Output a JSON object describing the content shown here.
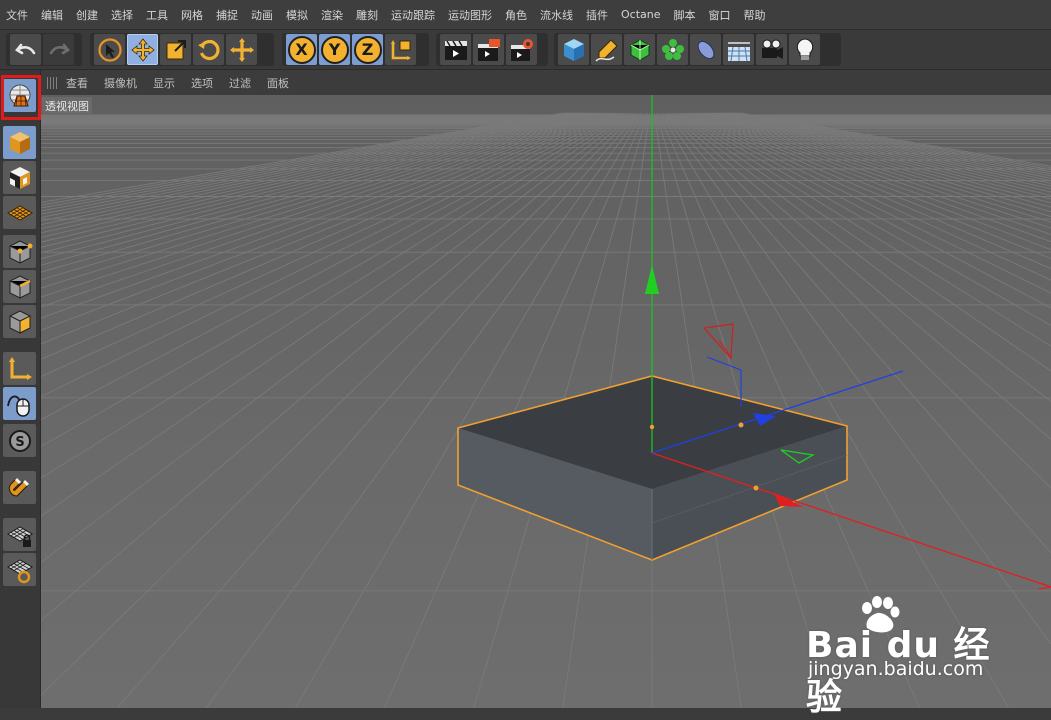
{
  "menubar": {
    "items": [
      "文件",
      "编辑",
      "创建",
      "选择",
      "工具",
      "网格",
      "捕捉",
      "动画",
      "模拟",
      "渲染",
      "雕刻",
      "运动跟踪",
      "运动图形",
      "角色",
      "流水线",
      "插件",
      "Octane",
      "脚本",
      "窗口",
      "帮助"
    ]
  },
  "toolbar": {
    "groups": [
      {
        "name": "history",
        "buttons": [
          "undo-icon",
          "redo-icon"
        ]
      },
      {
        "name": "transform",
        "buttons": [
          "live-select-icon",
          "move-icon",
          "scale-icon",
          "rotate-icon",
          "last-tool-icon"
        ]
      },
      {
        "name": "axis-lock",
        "buttons": [
          "x-axis-icon",
          "y-axis-icon",
          "z-axis-icon",
          "coordinate-system-icon"
        ]
      },
      {
        "name": "render",
        "buttons": [
          "render-view-icon",
          "render-picture-viewer-icon",
          "render-settings-icon"
        ]
      },
      {
        "name": "create",
        "buttons": [
          "cube-object-icon",
          "pen-spline-icon",
          "subdivision-surface-icon",
          "cloner-icon",
          "deformer-icon",
          "floor-environment-icon",
          "camera-icon",
          "light-icon"
        ]
      }
    ],
    "axis_labels": {
      "x": "X",
      "y": "Y",
      "z": "Z"
    }
  },
  "viewport_menu": {
    "items": [
      "查看",
      "摄像机",
      "显示",
      "选项",
      "过滤",
      "面板"
    ]
  },
  "viewport": {
    "label": "透视视图"
  },
  "left_toolbar": {
    "buttons": [
      "make-editable-icon",
      "model-mode-icon",
      "texture-mode-icon",
      "workplane-mode-icon",
      "points-mode-icon",
      "edges-mode-icon",
      "polygons-mode-icon",
      "axis-mode-icon",
      "tweak-mode-icon",
      "solo-icon",
      "snap-magnet-icon",
      "workplane-lock-icon",
      "workplane-align-icon"
    ],
    "highlighted": "make-editable-icon"
  },
  "colors": {
    "grid_line": "#7a7a7a",
    "object_outline": "#f0a030",
    "axis_x": "#e02020",
    "axis_y": "#20c020",
    "axis_z": "#2040e0",
    "highlight": "#e21a1a"
  },
  "watermark": {
    "logo": "Bai du 经验",
    "url": "jingyan.baidu.com"
  }
}
